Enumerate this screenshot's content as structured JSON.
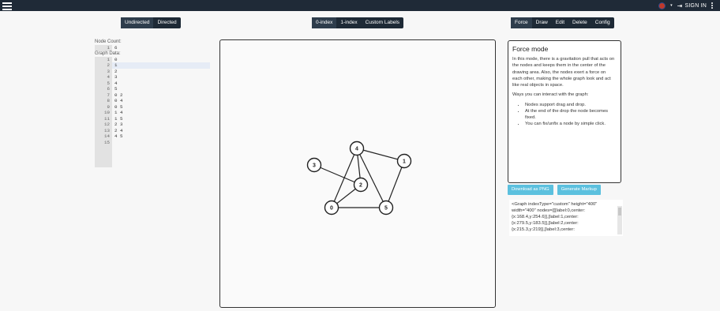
{
  "topbar": {
    "menu_icon": "hamburger-icon",
    "sign_in_label": "SIGN IN",
    "language_icon": "uk-flag-icon",
    "more_icon": "kebab-icon"
  },
  "direction_toggle": [
    {
      "label": "Undirected",
      "active": true
    },
    {
      "label": "Directed",
      "active": false
    }
  ],
  "index_toggle": [
    {
      "label": "0-index",
      "active": true
    },
    {
      "label": "1-index",
      "active": false
    },
    {
      "label": "Custom Labels",
      "active": false
    }
  ],
  "mode_toggle": [
    {
      "label": "Force",
      "active": true
    },
    {
      "label": "Draw",
      "active": false
    },
    {
      "label": "Edit",
      "active": false
    },
    {
      "label": "Delete",
      "active": false
    },
    {
      "label": "Config",
      "active": false
    }
  ],
  "left_panel": {
    "node_count_label": "Node Count:",
    "node_count_line": "1",
    "node_count_value": "6",
    "graph_data_label": "Graph Data:",
    "lines": [
      {
        "n": "1",
        "text": "0"
      },
      {
        "n": "2",
        "text": "1"
      },
      {
        "n": "3",
        "text": "2"
      },
      {
        "n": "4",
        "text": "3"
      },
      {
        "n": "5",
        "text": "4"
      },
      {
        "n": "6",
        "text": "5"
      },
      {
        "n": "7",
        "text": "0 2"
      },
      {
        "n": "8",
        "text": "0 4"
      },
      {
        "n": "9",
        "text": "0 5"
      },
      {
        "n": "10",
        "text": "1 4"
      },
      {
        "n": "11",
        "text": "1 5"
      },
      {
        "n": "12",
        "text": "2 3"
      },
      {
        "n": "13",
        "text": "2 4"
      },
      {
        "n": "14",
        "text": "4 5"
      },
      {
        "n": "15",
        "text": ""
      }
    ]
  },
  "graph": {
    "nodes": [
      "0",
      "1",
      "2",
      "3",
      "4",
      "5"
    ],
    "edges": [
      [
        "0",
        "2"
      ],
      [
        "0",
        "4"
      ],
      [
        "0",
        "5"
      ],
      [
        "1",
        "4"
      ],
      [
        "1",
        "5"
      ],
      [
        "2",
        "3"
      ],
      [
        "2",
        "4"
      ],
      [
        "4",
        "5"
      ]
    ]
  },
  "info": {
    "title": "Force mode",
    "p1": "In this mode, there is a gravitation pull that acts on the nodes and keeps them in the center of the drawing area. Also, the nodes exert a force on each other, making the whole graph look and act like real objects in space.",
    "p2": "Ways you can interact with the graph:",
    "bullets": [
      "Nodes support drag and drop.",
      "At the end of the drop the node becomes fixed.",
      "You can fix/unfix a node by simple click."
    ]
  },
  "buttons": {
    "download": "Download as PNG",
    "markup": "Generate Markup"
  },
  "output": {
    "lines": [
      "<Graph indexType=\"custom\" height=\"400\"",
      "width=\"400\" nodes={[[label:0,center:",
      "{x:168.4,y:254.6}],[label:1,center:",
      "{x:279.5,y:183.5}],[label:2,center:",
      "{x:215.3,y:219}],[label:3,center:"
    ]
  }
}
